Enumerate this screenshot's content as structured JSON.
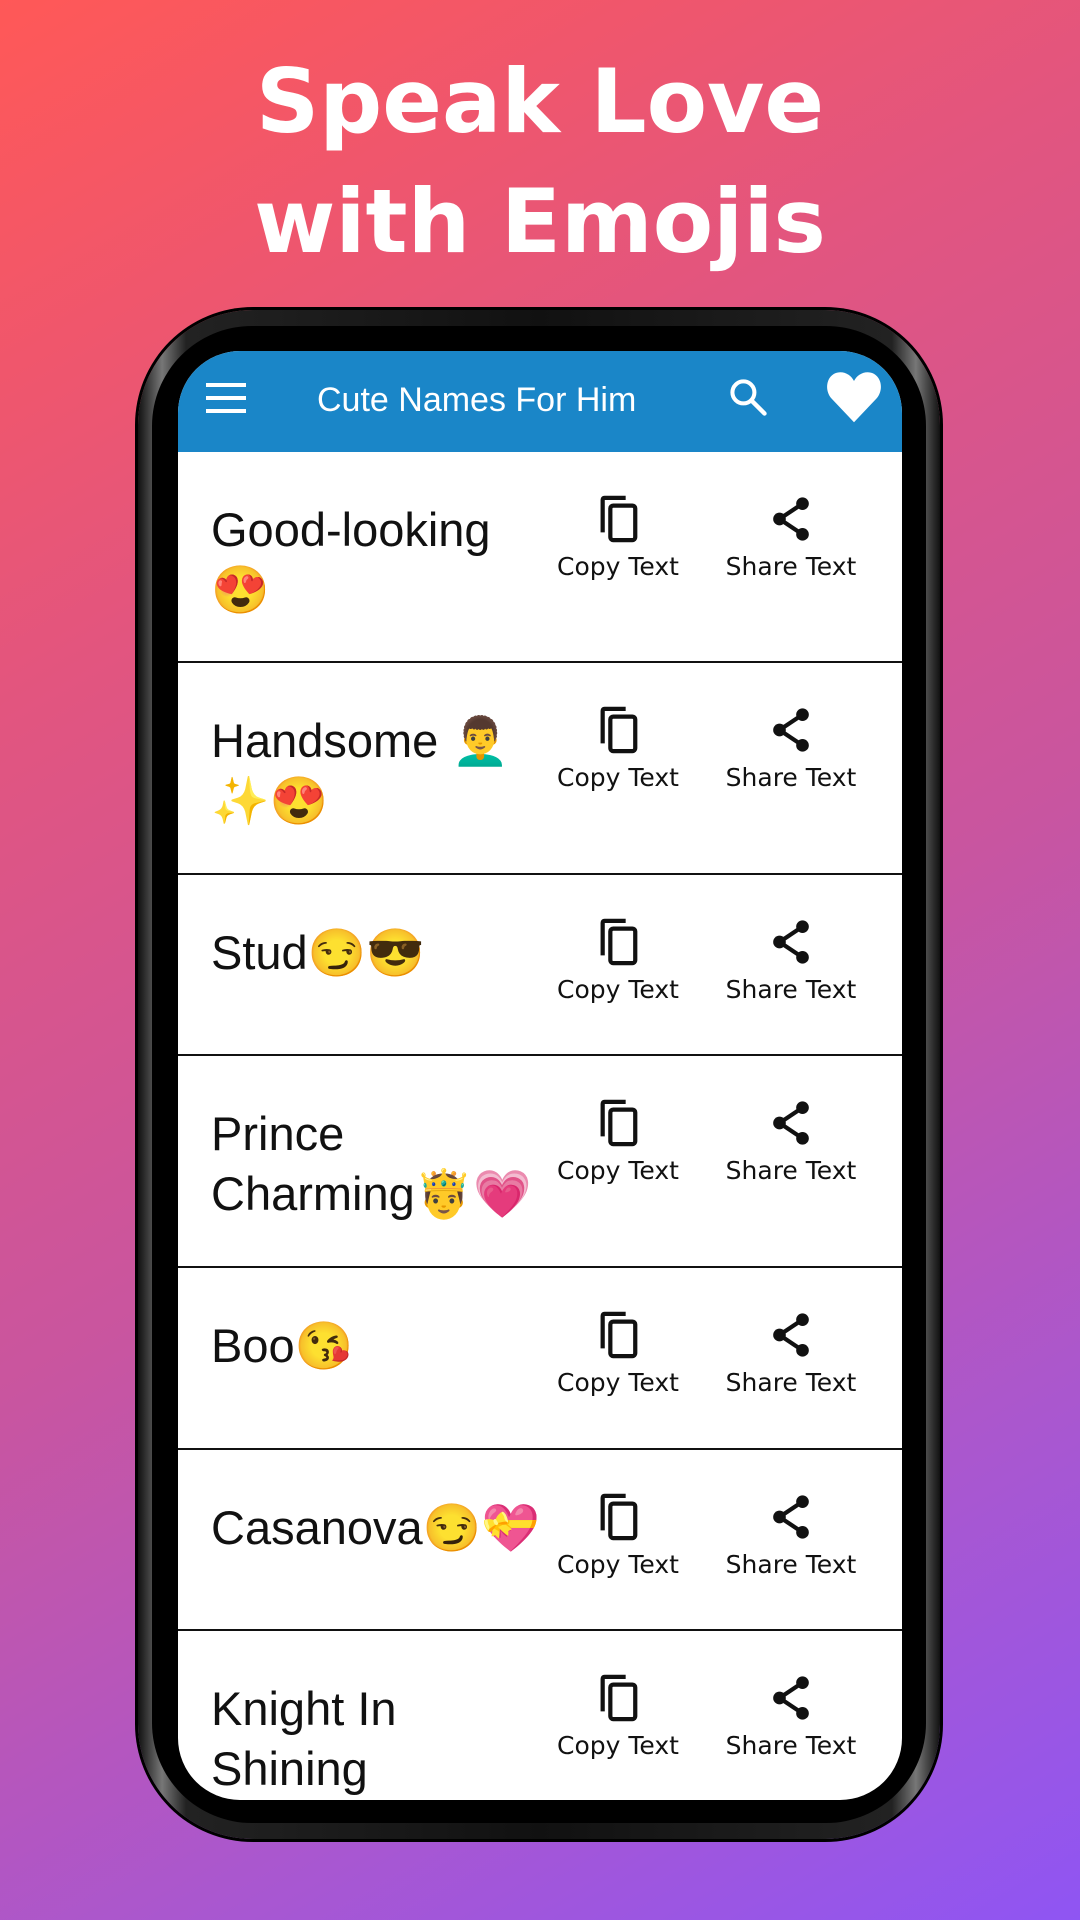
{
  "headline": {
    "line1": "Speak Love",
    "line2": "with Emojis"
  },
  "appbar": {
    "title": "Cute Names For Him",
    "menu_icon": "hamburger-menu-icon",
    "search_icon": "search-icon",
    "favorite_icon": "heart-icon"
  },
  "actions": {
    "copy_label": "Copy Text",
    "share_label": "Share Text"
  },
  "items": [
    {
      "name": "Good-looking 😍"
    },
    {
      "name": "Handsome 👨‍🦱✨😍"
    },
    {
      "name": "Stud😏😎"
    },
    {
      "name": "Prince Charming🤴💗"
    },
    {
      "name": "Boo😘"
    },
    {
      "name": "Casanova😏💝"
    },
    {
      "name": "Knight In Shining"
    }
  ],
  "colors": {
    "appbar": "#1a86c8",
    "background_start": "#ff5857",
    "background_end": "#8f55f3"
  }
}
